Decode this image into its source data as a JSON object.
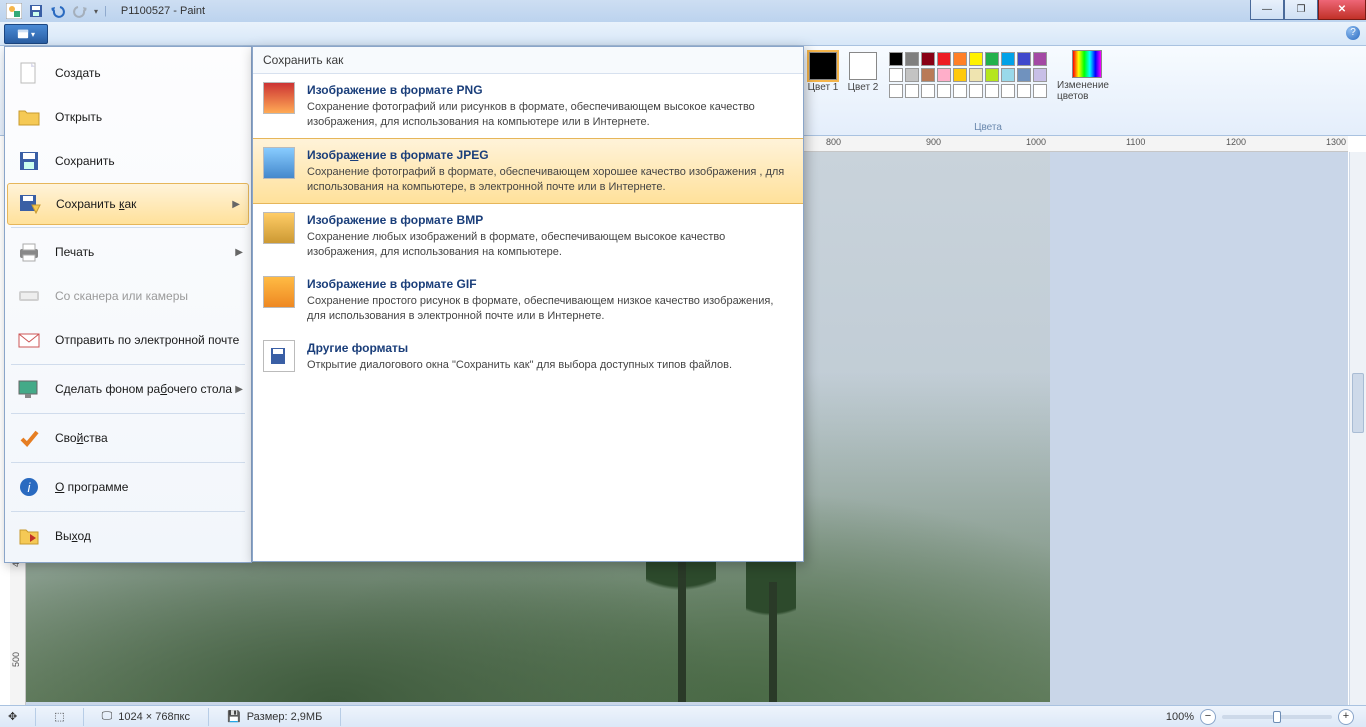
{
  "title": "P1100527 - Paint",
  "qat": {
    "save": "save-icon",
    "undo": "undo-icon",
    "redo": "redo-icon"
  },
  "ribbon": {
    "color1": "Цвет 1",
    "color2": "Цвет 2",
    "edit_colors": "Изменение цветов",
    "group": "Цвета"
  },
  "palette_rows": [
    [
      "#000000",
      "#7f7f7f",
      "#880015",
      "#ed1c24",
      "#ff7f27",
      "#fff200",
      "#22b14c",
      "#00a2e8",
      "#3f48cc",
      "#a349a4"
    ],
    [
      "#ffffff",
      "#c3c3c3",
      "#b97a57",
      "#ffaec9",
      "#ffc90e",
      "#efe4b0",
      "#b5e61d",
      "#99d9ea",
      "#7092be",
      "#c8bfe7"
    ],
    [
      "#ffffff",
      "#ffffff",
      "#ffffff",
      "#ffffff",
      "#ffffff",
      "#ffffff",
      "#ffffff",
      "#ffffff",
      "#ffffff",
      "#ffffff"
    ]
  ],
  "ruler_marks": [
    "800",
    "900",
    "1000",
    "1100",
    "1200",
    "1300"
  ],
  "vruler_marks": [
    "400",
    "500"
  ],
  "file_menu": {
    "create": "Создать",
    "open": "Открыть",
    "save": "Сохранить",
    "save_as": "Сохранить как",
    "print": "Печать",
    "scanner": "Со сканера или камеры",
    "email": "Отправить по электронной почте",
    "wallpaper": "Сделать фоном рабочего стола",
    "properties": "Свойства",
    "about": "О программе",
    "exit": "Выход"
  },
  "submenu": {
    "header": "Сохранить как",
    "png_t": "Изображение в формате PNG",
    "png_d": "Сохранение фотографий или рисунков в формате, обеспечивающем высокое качество изображения, для использования на компьютере или в Интернете.",
    "jpeg_t": "Изображение в формате JPEG",
    "jpeg_d": "Сохранение фотографий в формате, обеспечивающем хорошее качество изображения , для использования на компьютере, в электронной почте или в Интернете.",
    "bmp_t": "Изображение в формате BMP",
    "bmp_d": "Сохранение любых изображений в формате, обеспечивающем высокое качество изображения, для использования на компьютере.",
    "gif_t": "Изображение в формате GIF",
    "gif_d": "Сохранение простого рисунок в формате, обеспечивающем низкое качество изображения, для использования в электронной почте или в Интернете.",
    "other_t": "Другие форматы",
    "other_d": "Открытие диалогового окна \"Сохранить как\" для выбора доступных типов файлов."
  },
  "status": {
    "dims": "1024 × 768пкс",
    "size": "Размер: 2,9МБ",
    "zoom": "100%"
  }
}
